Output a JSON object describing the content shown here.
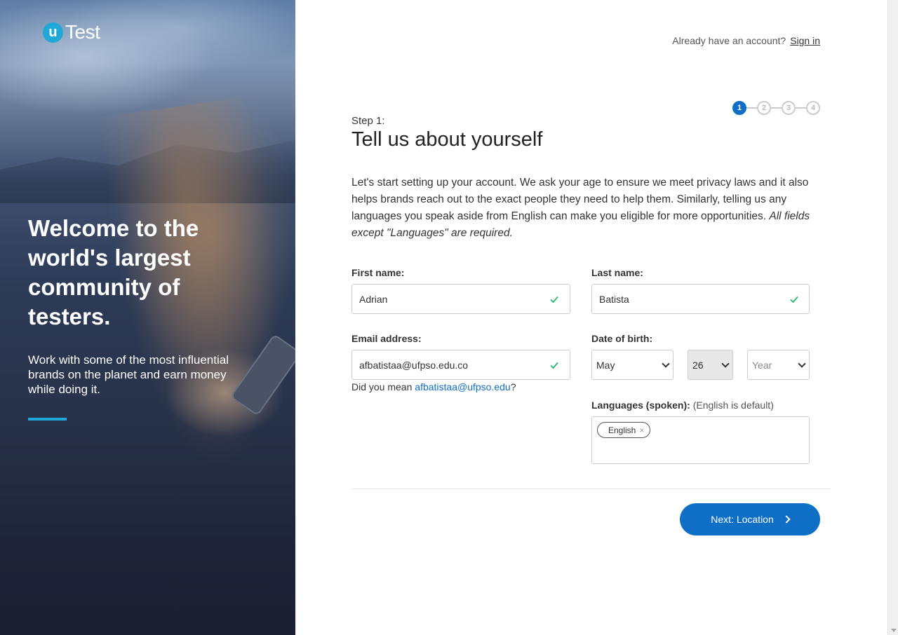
{
  "brand": {
    "logo_mark": "u",
    "logo_text": "Test",
    "accent": "#1fa8d8",
    "primary": "#0f6fc6"
  },
  "hero": {
    "headline": "Welcome to the world's largest community of testers.",
    "subtext": "Work with some of the most influential brands on the planet and earn money while doing it."
  },
  "header": {
    "already_text": "Already have an account?",
    "signin_label": "Sign in"
  },
  "stepper": {
    "steps": [
      "1",
      "2",
      "3",
      "4"
    ],
    "current": 1
  },
  "form": {
    "step_label": "Step 1:",
    "title": "Tell us about yourself",
    "intro": "Let's start setting up your account. We ask your age to ensure we meet privacy laws and it also helps brands reach out to the exact people they need to help them. Similarly, telling us any languages you speak aside from English can make you eligible for more opportunities. ",
    "intro_italic": "All fields except \"Languages\" are required.",
    "first_name": {
      "label": "First name:",
      "value": "Adrian"
    },
    "last_name": {
      "label": "Last name:",
      "value": "Batista"
    },
    "email": {
      "label": "Email address:",
      "value": "afbatistaa@ufpso.edu.co"
    },
    "suggestion": {
      "prefix": "Did you mean ",
      "email": "afbatistaa@ufpso.edu",
      "suffix": "?"
    },
    "dob": {
      "label": "Date of birth:",
      "month": "May",
      "day": "26",
      "year_placeholder": "Year"
    },
    "languages": {
      "label": "Languages (spoken):",
      "hint": "(English is default)",
      "tags": [
        "English"
      ],
      "remove_glyph": "×"
    },
    "next_label": "Next: Location"
  }
}
